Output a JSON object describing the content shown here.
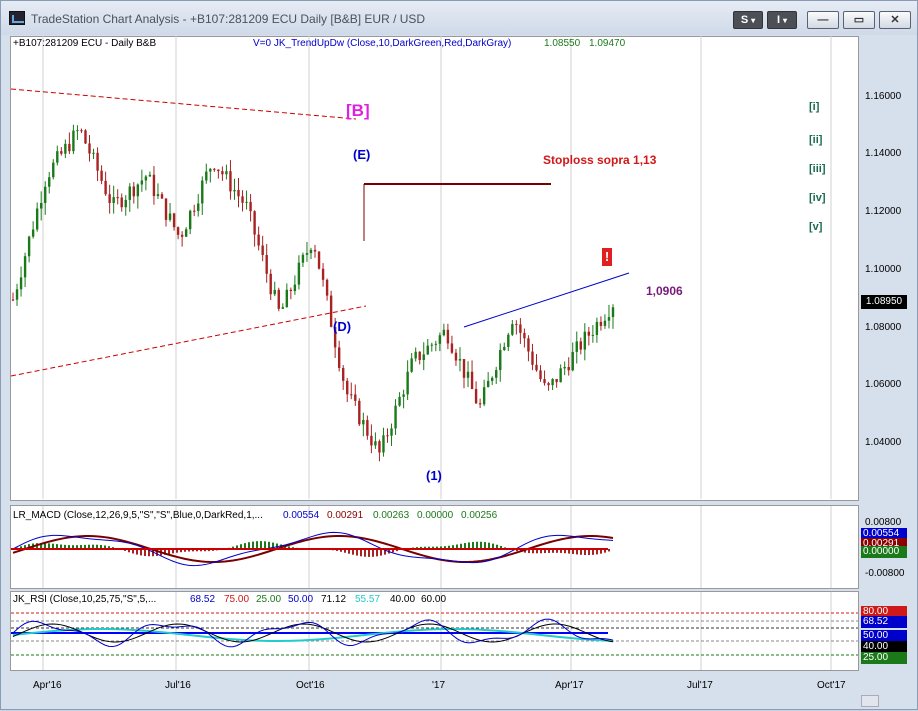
{
  "window": {
    "title": "TradeStation Chart Analysis - +B107:281209 ECU Daily [B&B] EUR / USD"
  },
  "toolbar": {
    "s_label": "S",
    "i_label": "I",
    "minimize": "—",
    "restore": "▭",
    "close": "✕"
  },
  "price_header": {
    "symbol": "+B107:281209 ECU - Daily  B&B",
    "indicator": "V=0  JK_TrendUpDw (Close,10,DarkGreen,Red,DarkGray)",
    "v1": "1.08550",
    "v2": "1.09470"
  },
  "price_axis": [
    "1.16000",
    "1.14000",
    "1.12000",
    "1.10000",
    "1.08000",
    "1.06000",
    "1.04000"
  ],
  "last_price": "1.08950",
  "annotations": {
    "B": "[B]",
    "E": "(E)",
    "D": "(D)",
    "one": "(1)",
    "stoploss": "Stoploss sopra 1,13",
    "target": "1,0906",
    "alert": "!",
    "waves": [
      "[i]",
      "[ii]",
      "[iii]",
      "[iv]",
      "[v]"
    ]
  },
  "macd": {
    "label": "LR_MACD (Close,12,26,9,5,\"S\",\"S\",Blue,0,DarkRed,1,...",
    "values": [
      "0.00554",
      "0.00291",
      "0.00263",
      "0.00000",
      "0.00256"
    ],
    "axis": [
      "0.00800",
      "-0.00800"
    ],
    "boxes": [
      "0.00554",
      "0.00291",
      "0.00000"
    ]
  },
  "rsi": {
    "label": "JK_RSI (Close,10,25,75,\"S\",5,...",
    "values": [
      "68.52",
      "75.00",
      "25.00",
      "50.00",
      "71.12",
      "55.57",
      "40.00",
      "60.00"
    ],
    "boxes": [
      "80.00",
      "68.52",
      "50.00",
      "40.00",
      "25.00"
    ]
  },
  "x_axis": [
    "Apr'16",
    "Jul'16",
    "Oct'16",
    "'17",
    "Apr'17",
    "Jul'17",
    "Oct'17"
  ],
  "colors": {
    "up": "#1a7a1a",
    "down": "#a82222",
    "accent": "#0000cc"
  },
  "chart_data": {
    "type": "candlestick",
    "title": "+B107:281209 ECU - Daily  B&B",
    "x": [
      "Apr'16",
      "Jul'16",
      "Oct'16",
      "'17",
      "Apr'17",
      "Jul'17",
      "Oct'17"
    ],
    "close_path": [
      1.09,
      1.13,
      1.145,
      1.12,
      1.13,
      1.11,
      1.135,
      1.12,
      1.085,
      1.11,
      1.06,
      1.04,
      1.07,
      1.08,
      1.055,
      1.085,
      1.06,
      1.075,
      1.089
    ],
    "ylim": [
      1.025,
      1.175
    ],
    "last": 1.0895
  }
}
